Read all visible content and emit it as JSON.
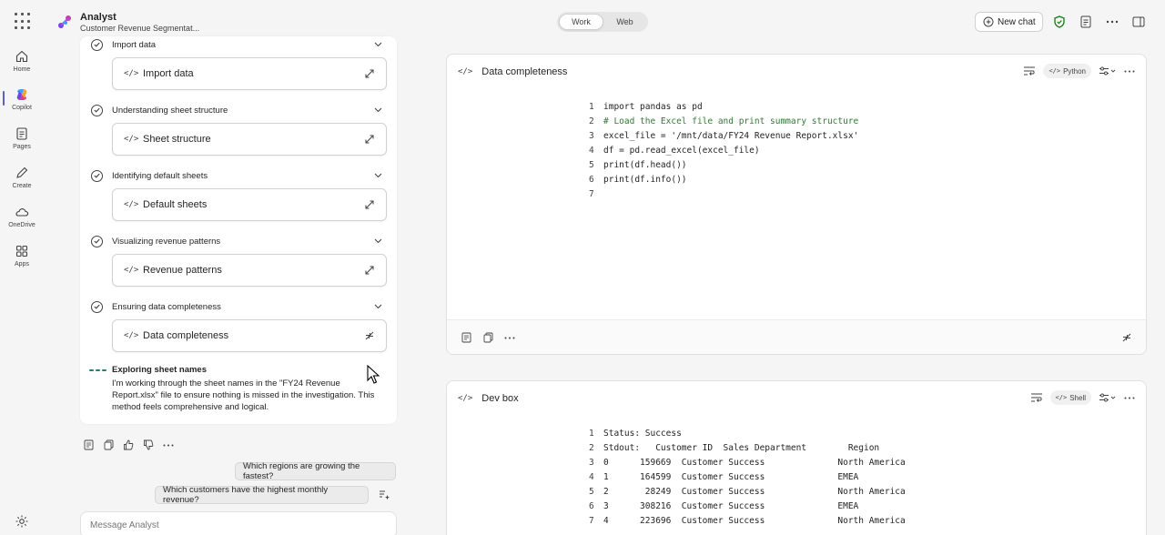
{
  "topbar": {
    "app_name": "Analyst",
    "subtitle": "Customer Revenue Segmentat...",
    "toggle": [
      "Work",
      "Web"
    ],
    "toggle_active": "Work",
    "new_chat": "New chat"
  },
  "rail": {
    "items": [
      {
        "label": "Home",
        "icon": "home-icon"
      },
      {
        "label": "Copilot",
        "icon": "copilot-icon"
      },
      {
        "label": "Pages",
        "icon": "pages-icon"
      },
      {
        "label": "Create",
        "icon": "create-icon"
      },
      {
        "label": "OneDrive",
        "icon": "onedrive-icon"
      },
      {
        "label": "Apps",
        "icon": "apps-icon"
      }
    ],
    "active": "Copilot"
  },
  "steps": [
    {
      "title": "Import data",
      "card": "Import data"
    },
    {
      "title": "Understanding sheet structure",
      "card": "Sheet structure"
    },
    {
      "title": "Identifying default sheets",
      "card": "Default sheets"
    },
    {
      "title": "Visualizing revenue patterns",
      "card": "Revenue patterns"
    },
    {
      "title": "Ensuring data completeness",
      "card": "Data completeness"
    }
  ],
  "exploring": {
    "title": "Exploring sheet names",
    "body": "I'm working through the sheet names in the \"FY24 Revenue Report.xlsx\" file to ensure nothing is missed in the investigation. This method feels comprehensive and logical."
  },
  "suggestions": [
    "Which regions are growing the fastest?",
    "Which customers have the highest monthly revenue?"
  ],
  "input": {
    "placeholder": "Message Analyst"
  },
  "panel1": {
    "title": "Data completeness",
    "lang": "Python",
    "lines": [
      "import pandas as pd",
      "# Load the Excel file and print summary structure",
      "excel_file = '/mnt/data/FY24 Revenue Report.xlsx'",
      "df = pd.read_excel(excel_file)",
      "print(df.head())",
      "print(df.info())",
      ""
    ]
  },
  "panel2": {
    "title": "Dev box",
    "lang": "Shell",
    "lines": [
      "Status: Success",
      "Stdout:   Customer ID  Sales Department        Region",
      "0      159669  Customer Success              North America",
      "1      164599  Customer Success              EMEA",
      "2       28249  Customer Success              North America",
      "3      308216  Customer Success              EMEA",
      "4      223696  Customer Success              North America"
    ]
  },
  "colors": {
    "accent": "#5b5fc7",
    "green": "#2a7c6f",
    "comment": "#2e7d32",
    "string": "#a31515"
  }
}
